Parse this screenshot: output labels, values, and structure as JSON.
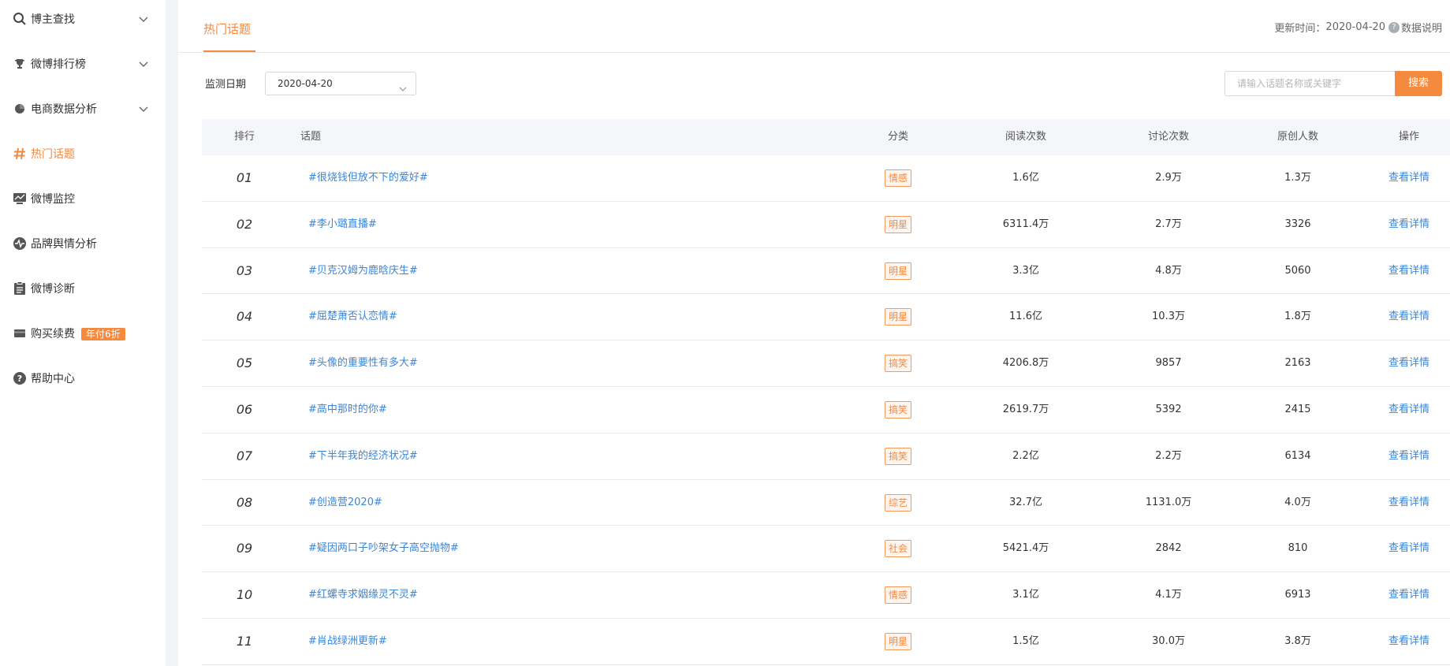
{
  "sidebar": {
    "items": [
      {
        "label": "博主查找",
        "icon": "search-icon",
        "expandable": true
      },
      {
        "label": "微博排行榜",
        "icon": "trophy-icon",
        "expandable": true
      },
      {
        "label": "电商数据分析",
        "icon": "pie-chart-icon",
        "expandable": true
      },
      {
        "label": "热门话题",
        "icon": "hashtag-icon",
        "active": true
      },
      {
        "label": "微博监控",
        "icon": "monitor-icon"
      },
      {
        "label": "品牌舆情分析",
        "icon": "pulse-icon"
      },
      {
        "label": "微博诊断",
        "icon": "clipboard-icon"
      },
      {
        "label": "购买续费",
        "icon": "card-icon",
        "badge": "年付6折"
      },
      {
        "label": "帮助中心",
        "icon": "help-icon"
      }
    ]
  },
  "header": {
    "tab": "热门话题",
    "update_label": "更新时间：",
    "update_date": "2020-04-20",
    "data_note": "数据说明"
  },
  "filters": {
    "date_label": "监测日期",
    "date_value": "2020-04-20",
    "search_placeholder": "请输入话题名称或关键字",
    "search_button": "搜索"
  },
  "table": {
    "headers": [
      "排行",
      "话题",
      "分类",
      "阅读次数",
      "讨论次数",
      "原创人数",
      "操作"
    ],
    "rows": [
      {
        "rank": "01",
        "topic": "#很烧钱但放不下的爱好#",
        "category": "情感",
        "reads": "1.6亿",
        "discussions": "2.9万",
        "originals": "1.3万",
        "action": "查看详情"
      },
      {
        "rank": "02",
        "topic": "#李小璐直播#",
        "category": "明星",
        "reads": "6311.4万",
        "discussions": "2.7万",
        "originals": "3326",
        "action": "查看详情"
      },
      {
        "rank": "03",
        "topic": "#贝克汉姆为鹿晗庆生#",
        "category": "明星",
        "reads": "3.3亿",
        "discussions": "4.8万",
        "originals": "5060",
        "action": "查看详情"
      },
      {
        "rank": "04",
        "topic": "#屈楚萧否认恋情#",
        "category": "明星",
        "reads": "11.6亿",
        "discussions": "10.3万",
        "originals": "1.8万",
        "action": "查看详情"
      },
      {
        "rank": "05",
        "topic": "#头像的重要性有多大#",
        "category": "搞笑",
        "reads": "4206.8万",
        "discussions": "9857",
        "originals": "2163",
        "action": "查看详情"
      },
      {
        "rank": "06",
        "topic": "#高中那时的你#",
        "category": "搞笑",
        "reads": "2619.7万",
        "discussions": "5392",
        "originals": "2415",
        "action": "查看详情"
      },
      {
        "rank": "07",
        "topic": "#下半年我的经济状况#",
        "category": "搞笑",
        "reads": "2.2亿",
        "discussions": "2.2万",
        "originals": "6134",
        "action": "查看详情"
      },
      {
        "rank": "08",
        "topic": "#创造营2020#",
        "category": "综艺",
        "reads": "32.7亿",
        "discussions": "1131.0万",
        "originals": "4.0万",
        "action": "查看详情"
      },
      {
        "rank": "09",
        "topic": "#疑因两口子吵架女子高空抛物#",
        "category": "社会",
        "reads": "5421.4万",
        "discussions": "2842",
        "originals": "810",
        "action": "查看详情"
      },
      {
        "rank": "10",
        "topic": "#红螺寺求姻缘灵不灵#",
        "category": "情感",
        "reads": "3.1亿",
        "discussions": "4.1万",
        "originals": "6913",
        "action": "查看详情"
      },
      {
        "rank": "11",
        "topic": "#肖战绿洲更新#",
        "category": "明星",
        "reads": "1.5亿",
        "discussions": "30.0万",
        "originals": "3.8万",
        "action": "查看详情"
      }
    ]
  },
  "colors": {
    "accent": "#f08a43",
    "link": "#3a85d8"
  }
}
